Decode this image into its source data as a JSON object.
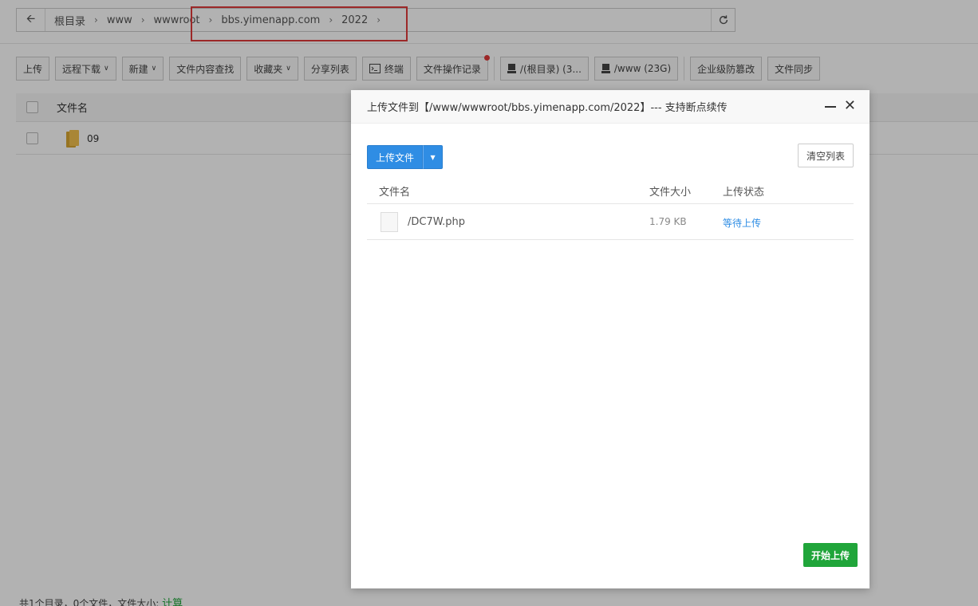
{
  "pathbar": {
    "back_icon": "arrow-left-icon",
    "crumbs": [
      "根目录",
      "www",
      "wwwroot",
      "bbs.yimenapp.com",
      "2022"
    ],
    "separator": "›",
    "refresh_icon": "refresh-icon"
  },
  "toolbar": {
    "upload": "上传",
    "remote_download": "远程下载",
    "new": "新建",
    "content_search": "文件内容查找",
    "favorites": "收藏夹",
    "share_list": "分享列表",
    "terminal": "终端",
    "operation_log": "文件操作记录",
    "disk_root": "/(根目录) (3...",
    "disk_www": "/www (23G)",
    "tamper_proof": "企业级防篡改",
    "file_sync": "文件同步"
  },
  "filelist": {
    "header_name": "文件名",
    "rows": [
      {
        "name": "09"
      }
    ]
  },
  "footer": {
    "summary": "共1个目录，0个文件，文件大小:",
    "calc": "计算"
  },
  "dialog": {
    "title": "上传文件到【/www/wwwroot/bbs.yimenapp.com/2022】--- 支持断点续传",
    "upload_file_btn": "上传文件",
    "clear_list_btn": "清空列表",
    "col_name": "文件名",
    "col_size": "文件大小",
    "col_status": "上传状态",
    "files": [
      {
        "name": "/DC7W.php",
        "size": "1.79 KB",
        "status": "等待上传"
      }
    ],
    "start_btn": "开始上传"
  },
  "colors": {
    "primary_blue": "#2f8de4",
    "success_green": "#20a53a",
    "highlight_red": "#e03a3a"
  }
}
